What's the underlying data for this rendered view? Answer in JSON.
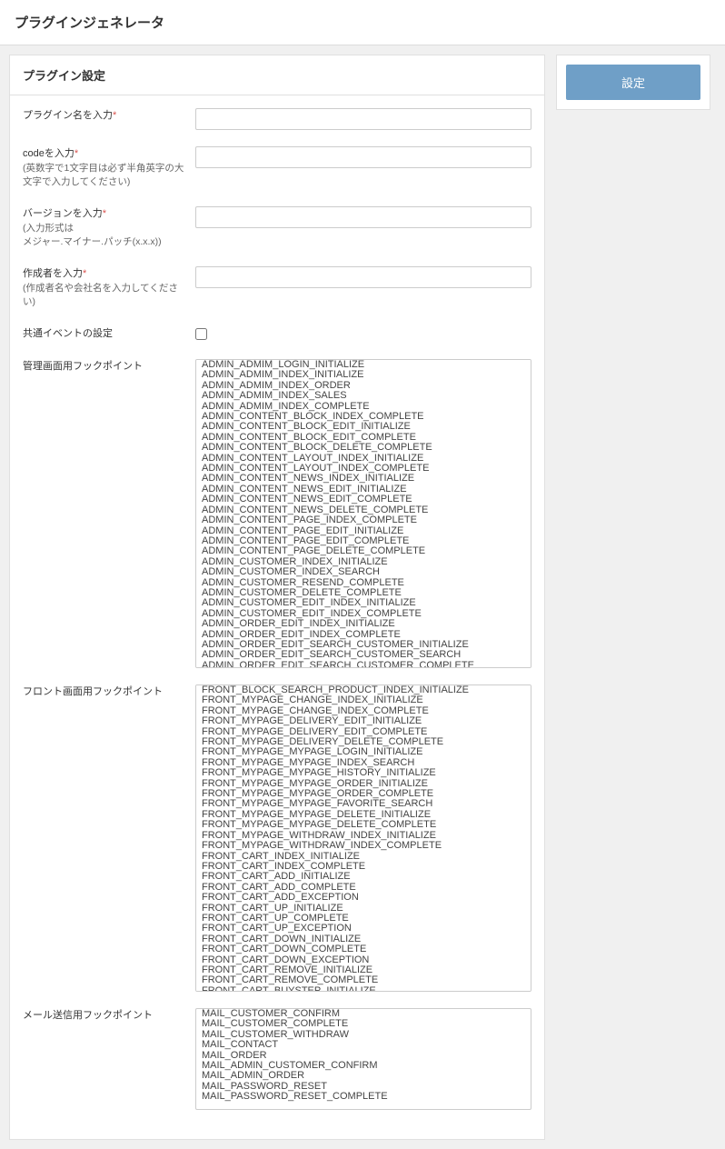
{
  "page_title": "プラグインジェネレータ",
  "panel_title": "プラグイン設定",
  "labels": {
    "plugin_name": "プラグイン名を入力",
    "code": "codeを入力",
    "code_hint": "(英数字で1文字目は必ず半角英字の大文字で入力してください)",
    "version": "バージョンを入力",
    "version_hint1": "(入力形式は",
    "version_hint2": "メジャー.マイナー.パッチ(x.x.x))",
    "author": "作成者を入力",
    "author_hint": "(作成者名や会社名を入力してください)",
    "common_event": "共通イベントの設定",
    "admin_hook": "管理画面用フックポイント",
    "front_hook": "フロント画面用フックポイント",
    "mail_hook": "メール送信用フックポイント"
  },
  "side_button": "設定",
  "admin_hooks": [
    "ADMIN_ADMIM_LOGIN_INITIALIZE",
    "ADMIN_ADMIM_INDEX_INITIALIZE",
    "ADMIN_ADMIM_INDEX_ORDER",
    "ADMIN_ADMIM_INDEX_SALES",
    "ADMIN_ADMIM_INDEX_COMPLETE",
    "ADMIN_CONTENT_BLOCK_INDEX_COMPLETE",
    "ADMIN_CONTENT_BLOCK_EDIT_INITIALIZE",
    "ADMIN_CONTENT_BLOCK_EDIT_COMPLETE",
    "ADMIN_CONTENT_BLOCK_DELETE_COMPLETE",
    "ADMIN_CONTENT_LAYOUT_INDEX_INITIALIZE",
    "ADMIN_CONTENT_LAYOUT_INDEX_COMPLETE",
    "ADMIN_CONTENT_NEWS_INDEX_INITIALIZE",
    "ADMIN_CONTENT_NEWS_EDIT_INITIALIZE",
    "ADMIN_CONTENT_NEWS_EDIT_COMPLETE",
    "ADMIN_CONTENT_NEWS_DELETE_COMPLETE",
    "ADMIN_CONTENT_PAGE_INDEX_COMPLETE",
    "ADMIN_CONTENT_PAGE_EDIT_INITIALIZE",
    "ADMIN_CONTENT_PAGE_EDIT_COMPLETE",
    "ADMIN_CONTENT_PAGE_DELETE_COMPLETE",
    "ADMIN_CUSTOMER_INDEX_INITIALIZE",
    "ADMIN_CUSTOMER_INDEX_SEARCH",
    "ADMIN_CUSTOMER_RESEND_COMPLETE",
    "ADMIN_CUSTOMER_DELETE_COMPLETE",
    "ADMIN_CUSTOMER_EDIT_INDEX_INITIALIZE",
    "ADMIN_CUSTOMER_EDIT_INDEX_COMPLETE",
    "ADMIN_ORDER_EDIT_INDEX_INITIALIZE",
    "ADMIN_ORDER_EDIT_INDEX_COMPLETE",
    "ADMIN_ORDER_EDIT_SEARCH_CUSTOMER_INITIALIZE",
    "ADMIN_ORDER_EDIT_SEARCH_CUSTOMER_SEARCH",
    "ADMIN_ORDER_EDIT_SEARCH_CUSTOMER_COMPLETE"
  ],
  "front_hooks": [
    "FRONT_BLOCK_SEARCH_PRODUCT_INDEX_INITIALIZE",
    "FRONT_MYPAGE_CHANGE_INDEX_INITIALIZE",
    "FRONT_MYPAGE_CHANGE_INDEX_COMPLETE",
    "FRONT_MYPAGE_DELIVERY_EDIT_INITIALIZE",
    "FRONT_MYPAGE_DELIVERY_EDIT_COMPLETE",
    "FRONT_MYPAGE_DELIVERY_DELETE_COMPLETE",
    "FRONT_MYPAGE_MYPAGE_LOGIN_INITIALIZE",
    "FRONT_MYPAGE_MYPAGE_INDEX_SEARCH",
    "FRONT_MYPAGE_MYPAGE_HISTORY_INITIALIZE",
    "FRONT_MYPAGE_MYPAGE_ORDER_INITIALIZE",
    "FRONT_MYPAGE_MYPAGE_ORDER_COMPLETE",
    "FRONT_MYPAGE_MYPAGE_FAVORITE_SEARCH",
    "FRONT_MYPAGE_MYPAGE_DELETE_INITIALIZE",
    "FRONT_MYPAGE_MYPAGE_DELETE_COMPLETE",
    "FRONT_MYPAGE_WITHDRAW_INDEX_INITIALIZE",
    "FRONT_MYPAGE_WITHDRAW_INDEX_COMPLETE",
    "FRONT_CART_INDEX_INITIALIZE",
    "FRONT_CART_INDEX_COMPLETE",
    "FRONT_CART_ADD_INITIALIZE",
    "FRONT_CART_ADD_COMPLETE",
    "FRONT_CART_ADD_EXCEPTION",
    "FRONT_CART_UP_INITIALIZE",
    "FRONT_CART_UP_COMPLETE",
    "FRONT_CART_UP_EXCEPTION",
    "FRONT_CART_DOWN_INITIALIZE",
    "FRONT_CART_DOWN_COMPLETE",
    "FRONT_CART_DOWN_EXCEPTION",
    "FRONT_CART_REMOVE_INITIALIZE",
    "FRONT_CART_REMOVE_COMPLETE",
    "FRONT_CART_BUYSTEP_INITIALIZE"
  ],
  "mail_hooks": [
    "MAIL_CUSTOMER_CONFIRM",
    "MAIL_CUSTOMER_COMPLETE",
    "MAIL_CUSTOMER_WITHDRAW",
    "MAIL_CONTACT",
    "MAIL_ORDER",
    "MAIL_ADMIN_CUSTOMER_CONFIRM",
    "MAIL_ADMIN_ORDER",
    "MAIL_PASSWORD_RESET",
    "MAIL_PASSWORD_RESET_COMPLETE"
  ]
}
